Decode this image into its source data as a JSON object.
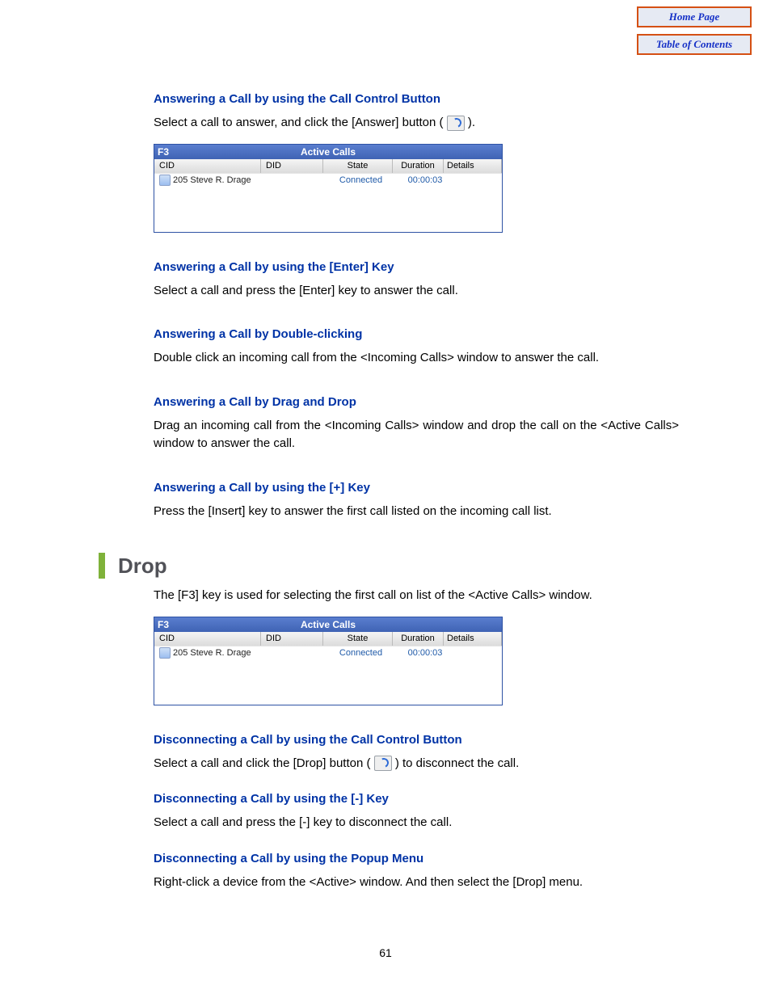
{
  "nav": {
    "home": "Home Page",
    "toc": "Table of Contents"
  },
  "sections": {
    "s1": {
      "heading": "Answering a Call by using the Call Control Button",
      "text_a": "Select a call to answer, and click the [Answer] button (",
      "text_b": ")."
    },
    "s2": {
      "heading": "Answering a Call by using the [Enter] Key",
      "text": "Select a call and press the [Enter] key to answer the call."
    },
    "s3": {
      "heading": "Answering a Call by Double-clicking",
      "text": "Double click an incoming call from the <Incoming Calls> window to answer the call."
    },
    "s4": {
      "heading": "Answering a Call by Drag and Drop",
      "text": "Drag an incoming call from the <Incoming Calls> window and drop the call on the <Active Calls> window to answer the call."
    },
    "s5": {
      "heading": "Answering a Call by using the [+] Key",
      "text": "Press the [Insert] key to answer the first call listed on the incoming call list."
    },
    "drop": {
      "title": "Drop",
      "intro": "The [F3] key is used for selecting the first call on list of the <Active Calls> window."
    },
    "d1": {
      "heading": "Disconnecting a Call by using the Call Control Button",
      "text_a": "Select a call and click the [Drop] button (",
      "text_b": ") to disconnect the call."
    },
    "d2": {
      "heading": "Disconnecting a Call by using the [-] Key",
      "text": "Select a call and press the [-] key to disconnect the call."
    },
    "d3": {
      "heading": "Disconnecting a Call by using the Popup Menu",
      "text": "Right-click a device from the <Active> window. And then select the [Drop] menu."
    }
  },
  "active_calls": {
    "fkey": "F3",
    "title": "Active Calls",
    "columns": {
      "cid": "CID",
      "did": "DID",
      "state": "State",
      "duration": "Duration",
      "details": "Details"
    },
    "row": {
      "cid": "205 Steve R. Drage",
      "did": "",
      "state": "Connected",
      "duration": "00:00:03",
      "details": ""
    }
  },
  "page_number": "61"
}
